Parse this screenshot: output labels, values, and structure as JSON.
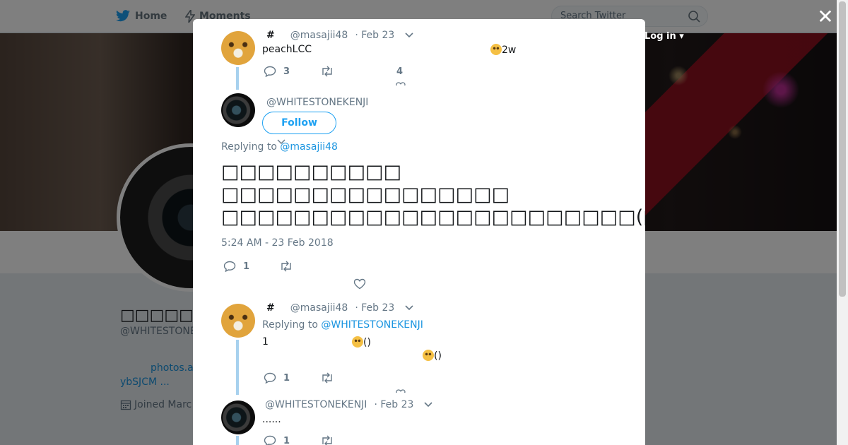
{
  "nav": {
    "home": "Home",
    "moments": "Moments",
    "search_placeholder": "Search Twitter",
    "login": "Log in"
  },
  "profile": {
    "name": "□□□□□",
    "handle": "@WHITESTONE",
    "link1": "photos.a",
    "link2": "ybSJCM      ...",
    "joined": "Joined Marc"
  },
  "modal": {
    "close": "✕",
    "tweet1": {
      "hash": "#",
      "handle": "@masajii48",
      "date": "· Feb 23",
      "text": "peachLCC",
      "text_right": "2w",
      "reply_count": "3",
      "like_count": "4"
    },
    "main": {
      "handle": "@WHITESTONEKENJI",
      "follow": "Follow",
      "replying_to": "Replying to",
      "replying_handle": "@masajii48",
      "line1": "□□□□□□□□□□",
      "line2": "□□□□□□□□□□□□□□□□",
      "line3": "□□□□□□□□□□□□□□□□□□□□□□□(□Д`)□□□□",
      "timestamp": "5:24 AM - 23 Feb 2018",
      "reply_count": "1"
    },
    "reply1": {
      "hash": "#",
      "handle": "@masajii48",
      "date": "· Feb 23",
      "replying_to": "Replying to",
      "replying_handle": "@WHITESTONEKENJI",
      "text_a": "1",
      "text_b": "()",
      "text_c": "()",
      "reply_count": "1"
    },
    "reply2": {
      "handle": "@WHITESTONEKENJI",
      "date": "· Feb 23",
      "text": "......",
      "reply_count": "1"
    }
  }
}
